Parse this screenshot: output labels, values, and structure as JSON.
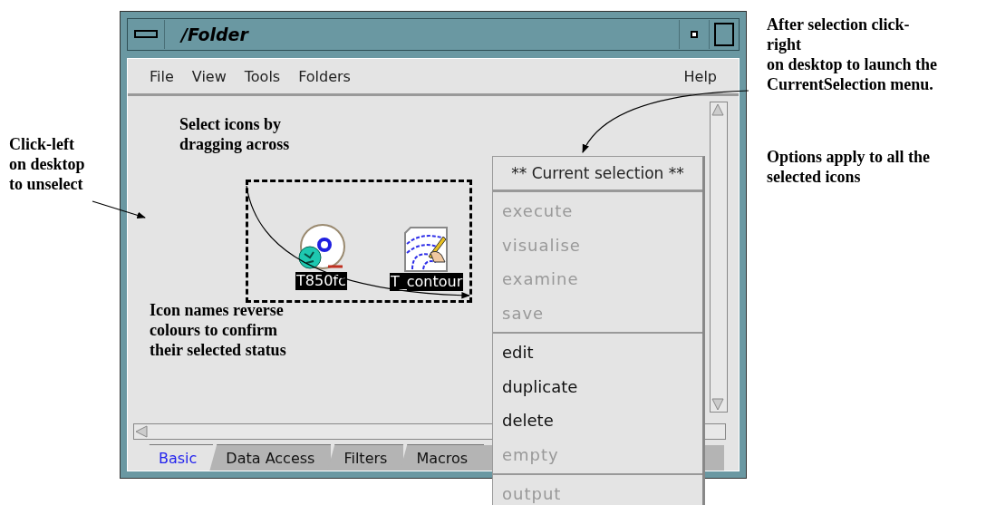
{
  "window": {
    "title": "/Folder"
  },
  "menubar": {
    "left": [
      "File",
      "View",
      "Tools",
      "Folders"
    ],
    "right": [
      "Help"
    ]
  },
  "desktop": {
    "icons": [
      {
        "label": "T850fc",
        "kind": "disc",
        "selected": true
      },
      {
        "label": "T_contour",
        "kind": "contour",
        "selected": true
      }
    ]
  },
  "tabs": [
    {
      "label": "Basic",
      "selected": true
    },
    {
      "label": "Data Access",
      "selected": false
    },
    {
      "label": "Filters",
      "selected": false
    },
    {
      "label": "Macros",
      "selected": false
    }
  ],
  "context_menu": {
    "title": "** Current selection **",
    "groups": [
      [
        {
          "label": "execute",
          "disabled": true
        },
        {
          "label": "visualise",
          "disabled": true
        },
        {
          "label": "examine",
          "disabled": true
        },
        {
          "label": "save",
          "disabled": true
        }
      ],
      [
        {
          "label": "edit",
          "disabled": false
        },
        {
          "label": "duplicate",
          "disabled": false
        },
        {
          "label": "delete",
          "disabled": false
        },
        {
          "label": "empty",
          "disabled": true
        }
      ],
      [
        {
          "label": "output",
          "disabled": true
        }
      ]
    ]
  },
  "annotations": {
    "left": "Click-left\non desktop\nto unselect",
    "select": "Select icons by\ndragging across",
    "names": "Icon names reverse\ncolours to confirm\ntheir selected status",
    "right": [
      "After selection click-\nright\non desktop to launch the\nCurrentSelection menu.",
      "Options apply to all the\nselected icons"
    ]
  }
}
